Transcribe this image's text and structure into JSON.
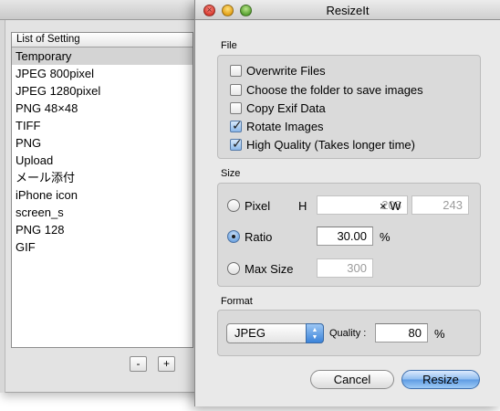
{
  "background_window": {
    "list_header": "List of Setting",
    "items": [
      "Temporary",
      "JPEG 800pixel",
      "JPEG 1280pixel",
      "PNG 48×48",
      "TIFF",
      "PNG",
      "Upload",
      "メール添付",
      "iPhone icon",
      "screen_s",
      "PNG 128",
      "GIF"
    ],
    "selected_index": 0,
    "remove_label": "-",
    "add_label": "+"
  },
  "dialog": {
    "title": "ResizeIt",
    "file": {
      "label": "File",
      "overwrite": {
        "label": "Overwrite Files",
        "checked": false
      },
      "choose_folder": {
        "label": "Choose the folder to save images",
        "checked": false
      },
      "copy_exif": {
        "label": "Copy Exif Data",
        "checked": false
      },
      "rotate": {
        "label": "Rotate Images",
        "checked": true
      },
      "high_quality": {
        "label": "High Quality (Takes longer time)",
        "checked": true
      }
    },
    "size": {
      "label": "Size",
      "pixel": {
        "label": "Pixel",
        "selected": false,
        "h_label": "H",
        "h_value": "208",
        "x_label": "× W",
        "w_value": "243"
      },
      "ratio": {
        "label": "Ratio",
        "selected": true,
        "value": "30.00",
        "unit": "%"
      },
      "max_size": {
        "label": "Max Size",
        "selected": false,
        "value": "300"
      }
    },
    "format": {
      "label": "Format",
      "selected": "JPEG",
      "quality_label": "Quality :",
      "quality_value": "80",
      "quality_unit": "%"
    },
    "buttons": {
      "cancel": "Cancel",
      "resize": "Resize"
    }
  },
  "colors": {
    "accent": "#5d9be3",
    "selection": "#d4d4d4",
    "dialog_bg": "#e9e9e9"
  }
}
